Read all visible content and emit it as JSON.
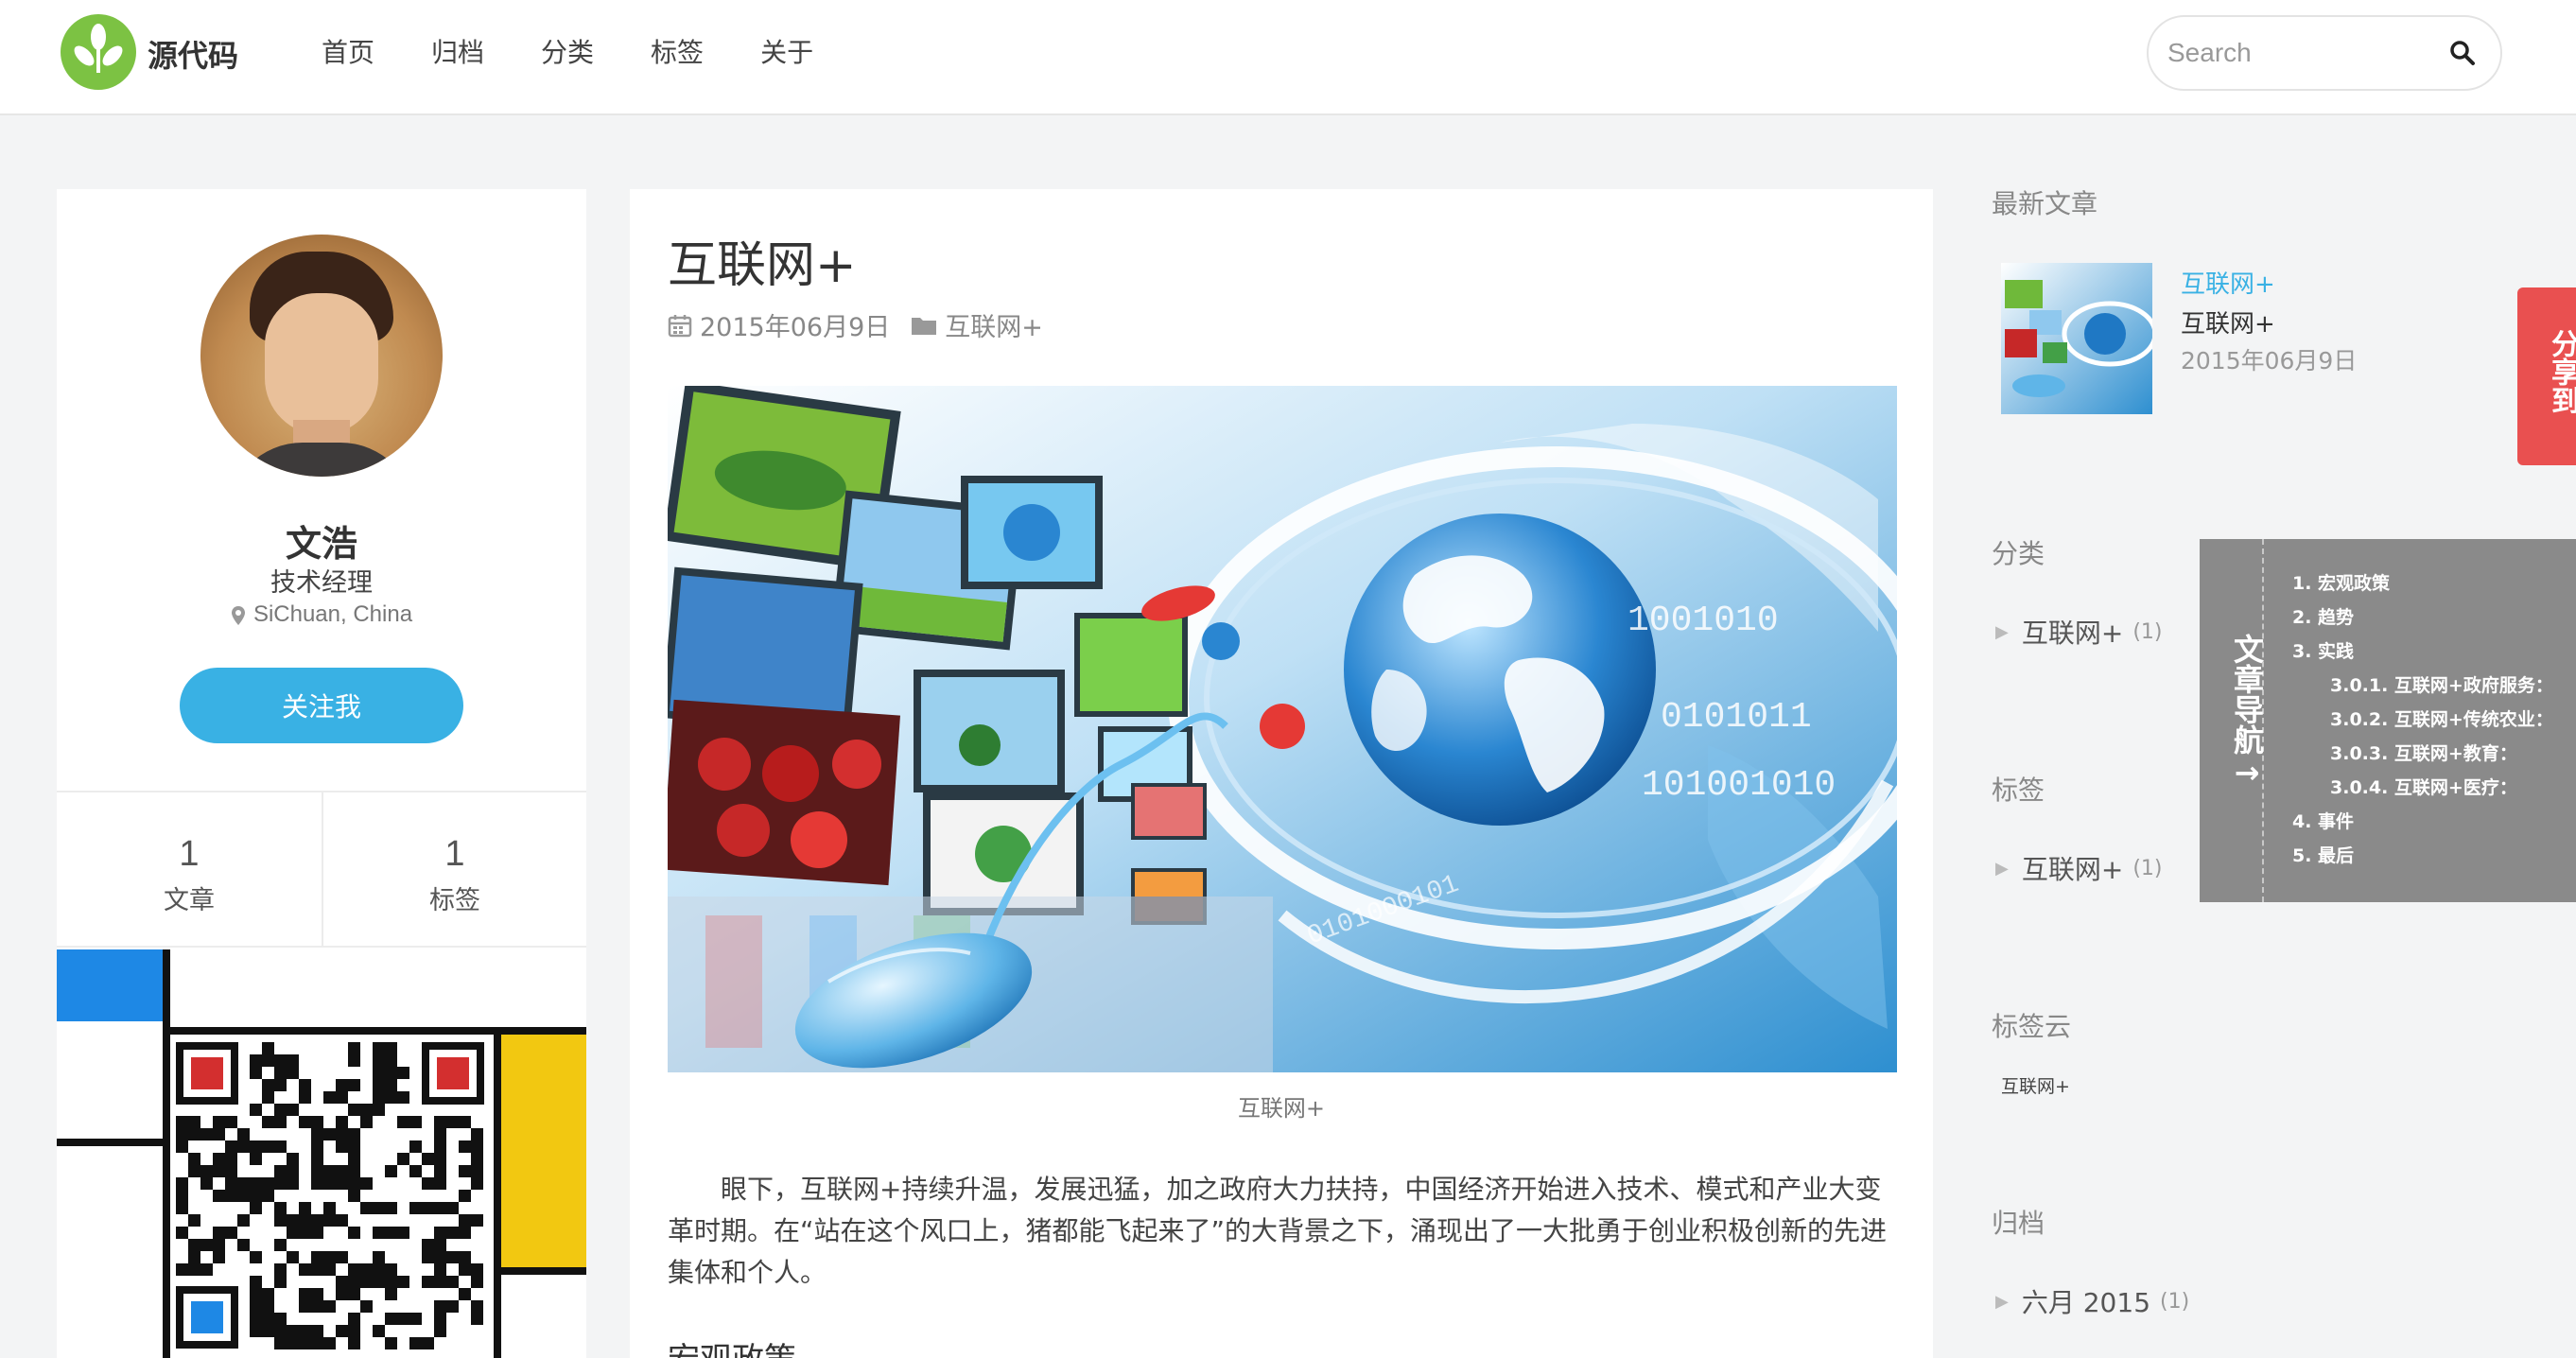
{
  "header": {
    "logo_text": "源代码",
    "nav": [
      "首页",
      "归档",
      "分类",
      "标签",
      "关于"
    ],
    "search_placeholder": "Search"
  },
  "profile": {
    "name": "文浩",
    "title": "技术经理",
    "location": "SiChuan, China",
    "follow_label": "关注我",
    "stats": [
      {
        "value": "1",
        "label": "文章"
      },
      {
        "value": "1",
        "label": "标签"
      }
    ]
  },
  "article": {
    "title": "互联网+",
    "date": "2015年06月9日",
    "category": "互联网+",
    "caption": "互联网+",
    "paragraph": "眼下，互联网+持续升温，发展迅猛，加之政府大力扶持，中国经济开始进入技术、模式和产业大变革时期。在“站在这个风口上，猪都能飞起来了”的大背景之下，涌现出了一大批勇于创业积极创新的先进集体和个人。",
    "section_heading": "宏观政策"
  },
  "sidebar": {
    "recent_title": "最新文章",
    "recent_link": "互联网+",
    "recent_sub": "互联网+",
    "recent_date": "2015年06月9日",
    "categories_title": "分类",
    "category_item": {
      "label": "互联网+",
      "count": "(1)"
    },
    "tags_title": "标签",
    "tag_item": {
      "label": "互联网+",
      "count": "(1)"
    },
    "tagcloud_title": "标签云",
    "tagcloud_item": "互联网+",
    "archive_title": "归档",
    "archive_item": {
      "label": "六月 2015",
      "count": "(1)"
    }
  },
  "share_tab": "分享到",
  "toc": {
    "tab_label": "文章导航→",
    "items": [
      "1. 宏观政策",
      "2. 趋势",
      "3. 实践",
      "3.0.1. 互联网+政府服务：",
      "3.0.2. 互联网+传统农业：",
      "3.0.3. 互联网+教育：",
      "3.0.4. 互联网+医疗：",
      "4. 事件",
      "5. 最后"
    ]
  },
  "colors": {
    "accent_blue": "#39b1e4",
    "logo_green": "#7cc243",
    "share_red": "#e95050",
    "toc_gray": "#8a8a8a",
    "background": "#f3f4f5"
  }
}
